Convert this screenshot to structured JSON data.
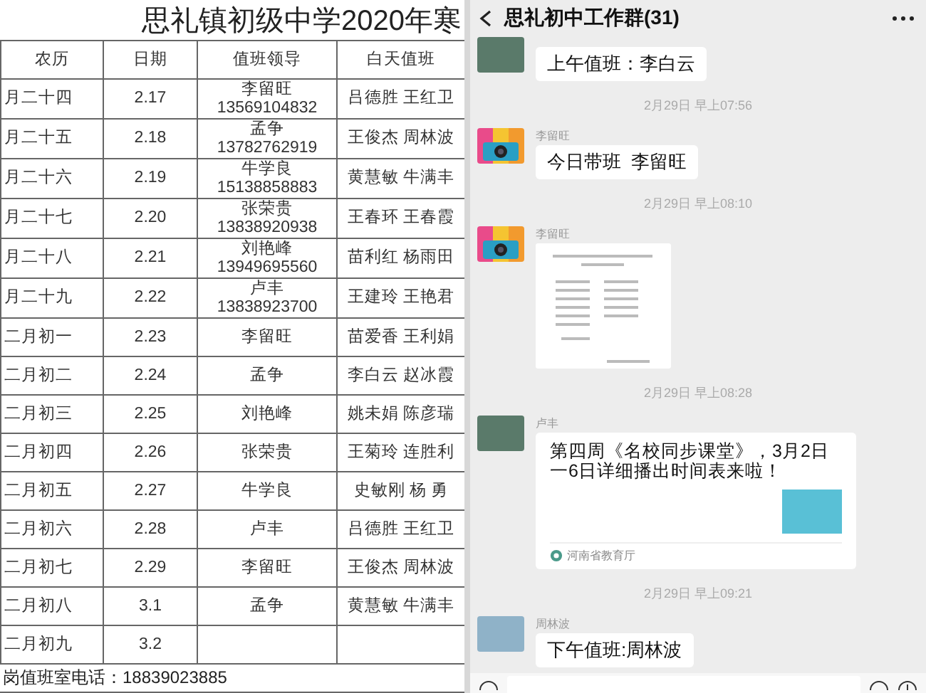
{
  "schedule": {
    "title": "思礼镇初级中学2020年寒",
    "columns": [
      "农历",
      "日期",
      "值班领导",
      "白天值班"
    ],
    "rows": [
      {
        "lunar": "月二十四",
        "date": "2.17",
        "leader": "李留旺",
        "phone": "13569104832",
        "day_duty": "吕德胜 王红卫"
      },
      {
        "lunar": "月二十五",
        "date": "2.18",
        "leader": "孟争",
        "phone": "13782762919",
        "day_duty": "王俊杰 周林波"
      },
      {
        "lunar": "月二十六",
        "date": "2.19",
        "leader": "牛学良",
        "phone": "15138858883",
        "day_duty": "黄慧敏 牛满丰"
      },
      {
        "lunar": "月二十七",
        "date": "2.20",
        "leader": "张荣贵",
        "phone": "13838920938",
        "day_duty": "王春环 王春霞"
      },
      {
        "lunar": "月二十八",
        "date": "2.21",
        "leader": "刘艳峰",
        "phone": "13949695560",
        "day_duty": "苗利红 杨雨田"
      },
      {
        "lunar": "月二十九",
        "date": "2.22",
        "leader": "卢丰",
        "phone": "13838923700",
        "day_duty": "王建玲 王艳君"
      },
      {
        "lunar": "二月初一",
        "date": "2.23",
        "leader": "李留旺",
        "day_duty": "苗爱香 王利娟"
      },
      {
        "lunar": "二月初二",
        "date": "2.24",
        "leader": "孟争",
        "day_duty": "李白云 赵冰霞"
      },
      {
        "lunar": "二月初三",
        "date": "2.25",
        "leader": "刘艳峰",
        "day_duty": "姚未娟 陈彦瑞"
      },
      {
        "lunar": "二月初四",
        "date": "2.26",
        "leader": "张荣贵",
        "day_duty": "王菊玲 连胜利"
      },
      {
        "lunar": "二月初五",
        "date": "2.27",
        "leader": "牛学良",
        "day_duty": "史敏刚 杨 勇"
      },
      {
        "lunar": "二月初六",
        "date": "2.28",
        "leader": "卢丰",
        "day_duty": "吕德胜 王红卫"
      },
      {
        "lunar": "二月初七",
        "date": "2.29",
        "leader": "李留旺",
        "day_duty": "王俊杰 周林波"
      },
      {
        "lunar": "二月初八",
        "date": "3.1",
        "leader": "孟争",
        "day_duty": "黄慧敏 牛满丰"
      },
      {
        "lunar": "二月初九",
        "date": "3.2"
      }
    ],
    "footer": "岗值班室电话：18839023885"
  },
  "chat": {
    "title": "思礼初中工作群(31)",
    "messages": [
      {
        "kind": "text",
        "text": "上午值班：李白云"
      },
      {
        "kind": "time",
        "text": "2月29日 早上07:56"
      },
      {
        "kind": "text",
        "sender": "李留旺",
        "text": "今日带班  李留旺"
      },
      {
        "kind": "time",
        "text": "2月29日 早上08:10"
      },
      {
        "kind": "image",
        "sender": "李留旺"
      },
      {
        "kind": "time",
        "text": "2月29日 早上08:28"
      },
      {
        "kind": "link",
        "sender": "卢丰",
        "text": "第四周《名校同步课堂》，3月2日一6日详细播出时间表来啦！",
        "source": "河南省教育厅"
      },
      {
        "kind": "time",
        "text": "2月29日 早上09:21"
      },
      {
        "kind": "text",
        "sender": "周林波",
        "text": "下午值班:周林波"
      }
    ]
  }
}
